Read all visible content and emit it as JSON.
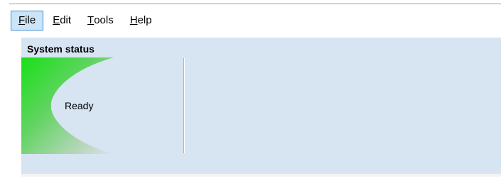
{
  "menubar": {
    "items": [
      {
        "mnemonic": "F",
        "rest": "ile",
        "active": true
      },
      {
        "mnemonic": "E",
        "rest": "dit",
        "active": false
      },
      {
        "mnemonic": "T",
        "rest": "ools",
        "active": false
      },
      {
        "mnemonic": "H",
        "rest": "elp",
        "active": false
      }
    ]
  },
  "status_group": {
    "title": "System status",
    "status_text": "Ready",
    "indicator_color": "#22e022"
  },
  "colors": {
    "panel_background": "#d7e4f2",
    "menu_highlight": "#cce4f7",
    "menu_highlight_border": "#3c8fd6"
  }
}
